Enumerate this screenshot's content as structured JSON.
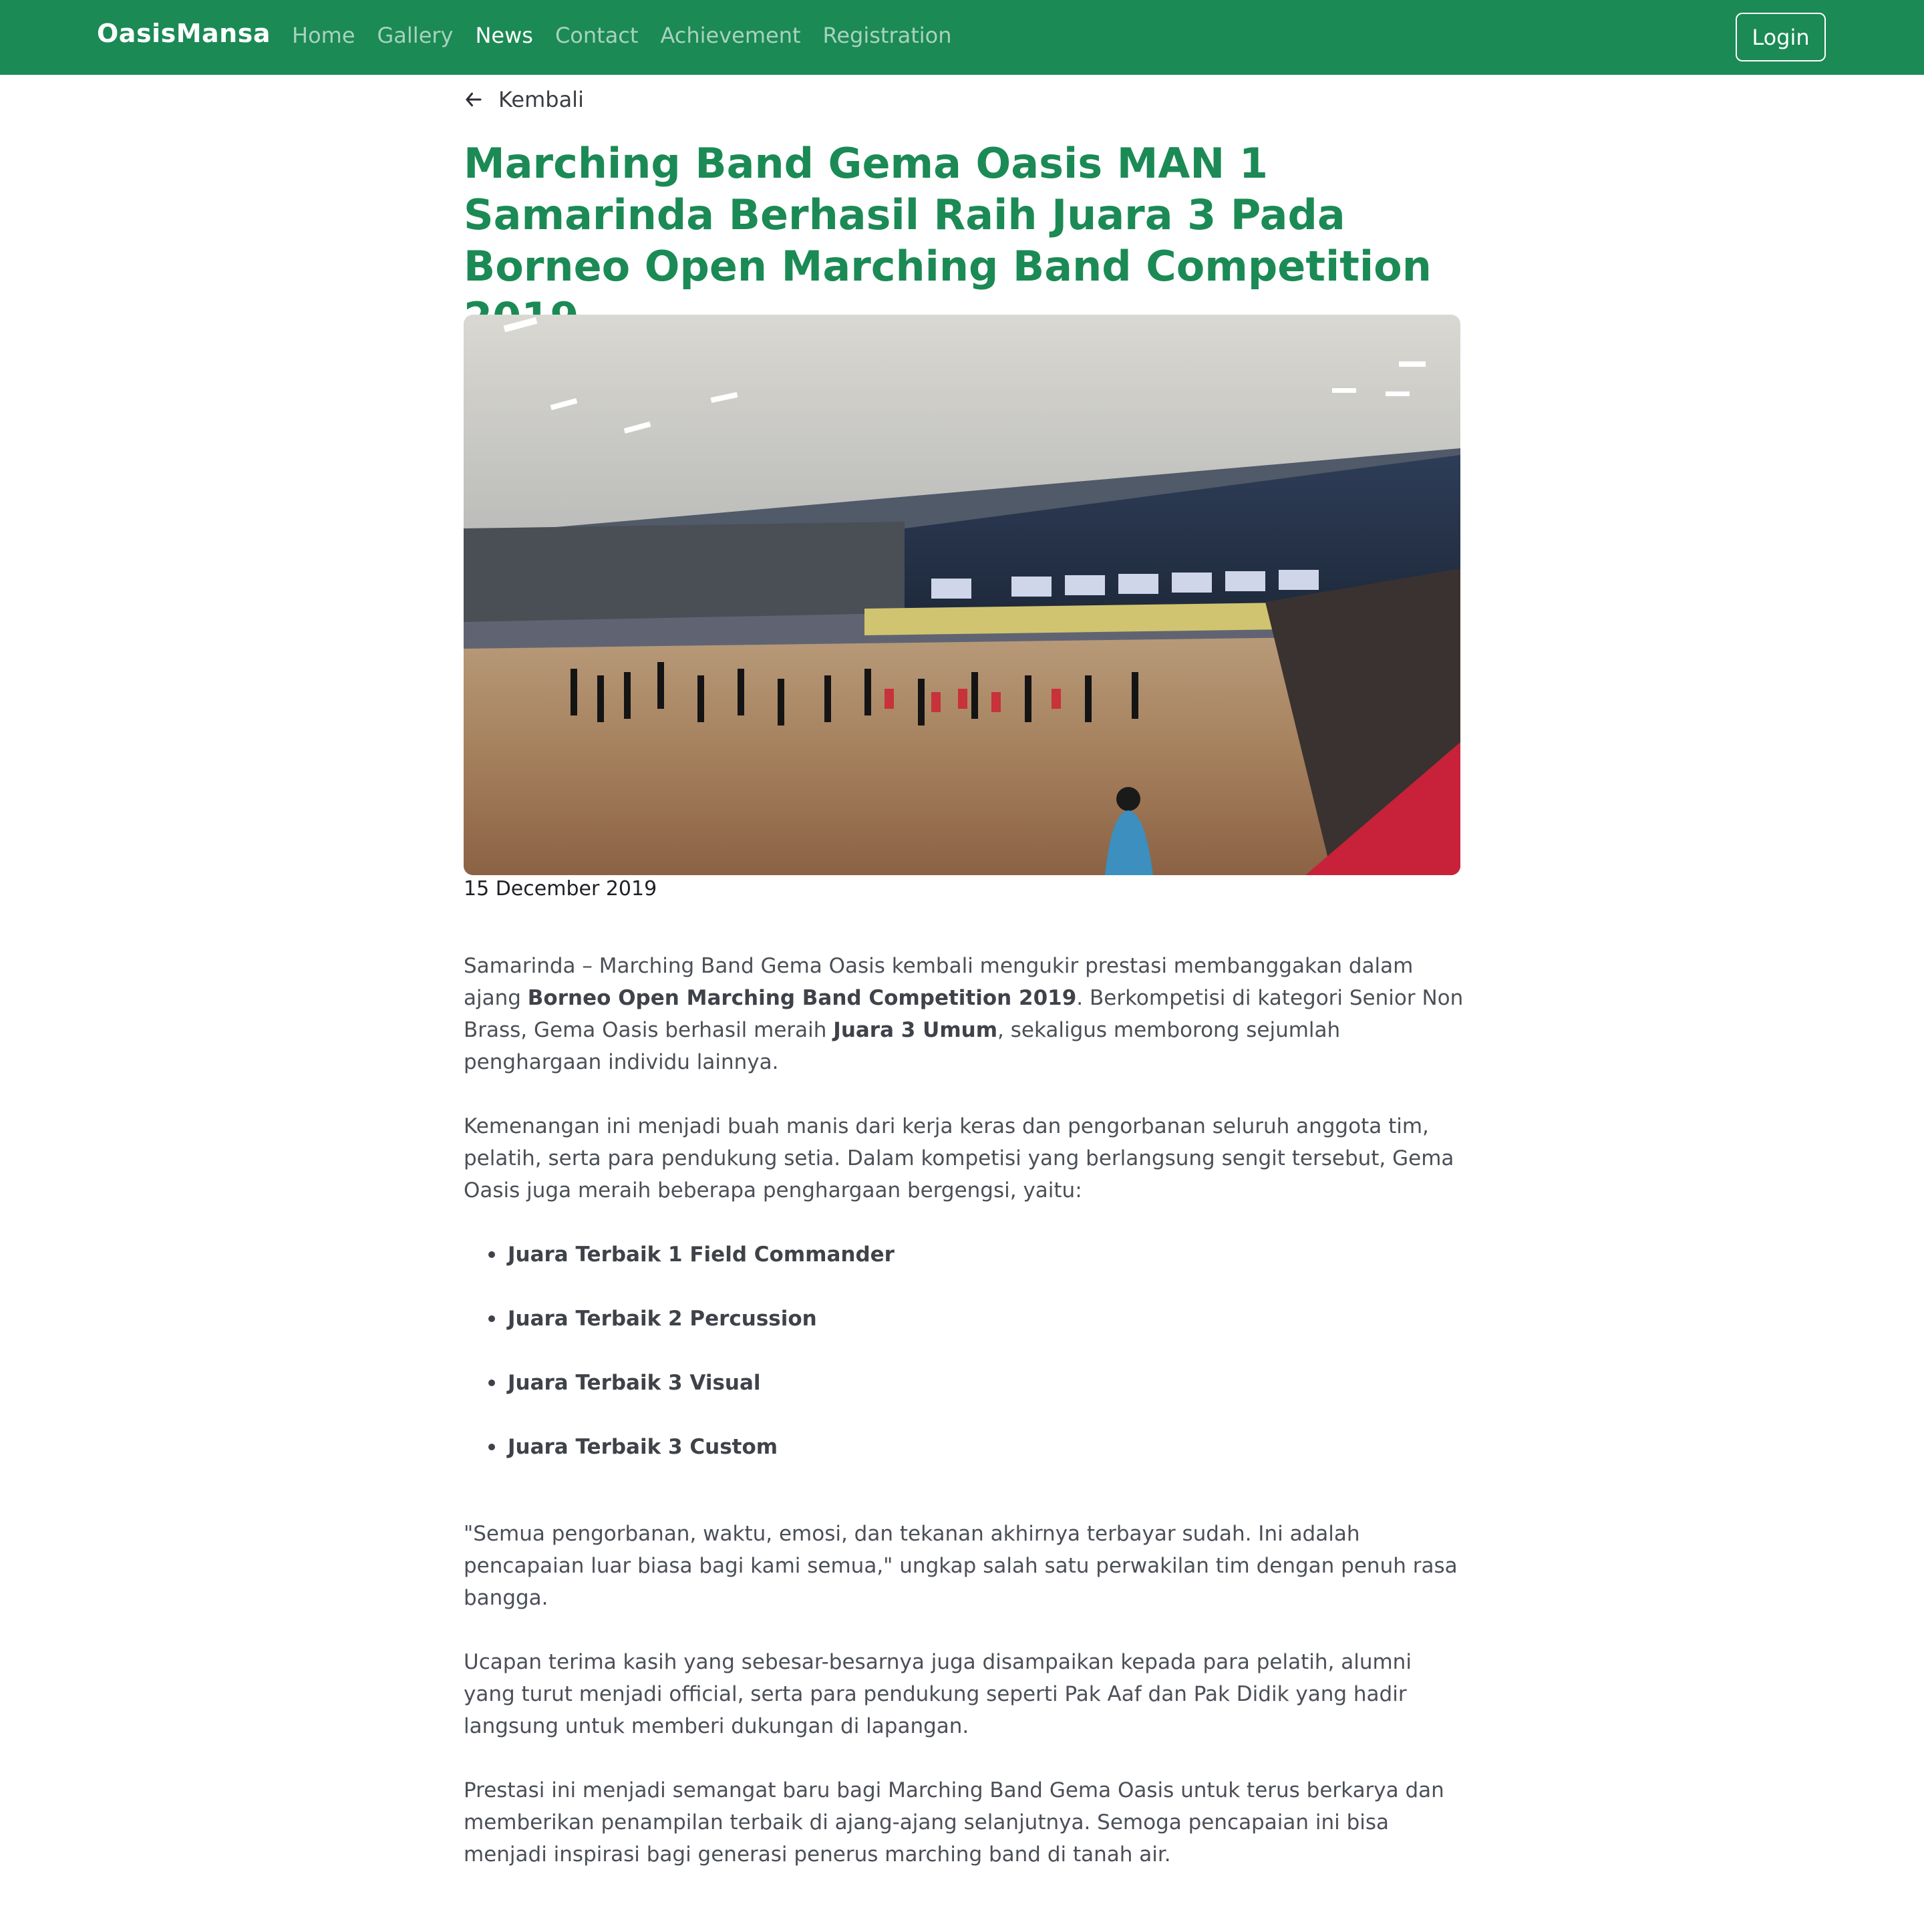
{
  "nav": {
    "brand": "OasisMansa",
    "links": [
      "Home",
      "Gallery",
      "News",
      "Contact",
      "Achievement",
      "Registration"
    ],
    "active": "News",
    "login": "Login"
  },
  "back": {
    "label": "Kembali",
    "icon": "arrow-left-icon"
  },
  "article": {
    "title": "Marching Band Gema Oasis MAN 1 Samarinda Berhasil Raih Juara 3 Pada Borneo Open Marching Band Competition 2019",
    "date": "15 December 2019",
    "p1": {
      "a": "Samarinda – Marching Band Gema Oasis kembali mengukir prestasi membanggakan dalam ajang ",
      "b": "Borneo Open Marching Band Competition 2019",
      "c": ". Berkompetisi di kategori Senior Non Brass, Gema Oasis berhasil meraih ",
      "d": "Juara 3 Umum",
      "e": ", sekaligus memborong sejumlah penghargaan individu lainnya."
    },
    "p2": "Kemenangan ini menjadi buah manis dari kerja keras dan pengorbanan seluruh anggota tim, pelatih, serta para pendukung setia. Dalam kompetisi yang berlangsung sengit tersebut, Gema Oasis juga meraih beberapa penghargaan bergengsi, yaitu:",
    "awards": [
      "Juara Terbaik 1 Field Commander",
      "Juara Terbaik 2 Percussion",
      "Juara Terbaik 3 Visual",
      "Juara Terbaik 3 Custom"
    ],
    "p3": "\"Semua pengorbanan, waktu, emosi, dan tekanan akhirnya terbayar sudah. Ini adalah pencapaian luar biasa bagi kami semua,\" ungkap salah satu perwakilan tim dengan penuh rasa bangga.",
    "p4": "Ucapan terima kasih yang sebesar-besarnya juga disampaikan kepada para pelatih, alumni yang turut menjadi official, serta para pendukung seperti Pak Aaf dan Pak Didik yang hadir langsung untuk memberi dukungan di lapangan.",
    "p5": "Prestasi ini menjadi semangat baru bagi Marching Band Gema Oasis untuk terus berkarya dan memberikan penampilan terbaik di ajang-ajang selanjutnya. Semoga pencapaian ini bisa menjadi inspirasi bagi generasi penerus marching band di tanah air."
  },
  "colors": {
    "brand_green": "#1b8a55",
    "text": "#4b4f56"
  }
}
